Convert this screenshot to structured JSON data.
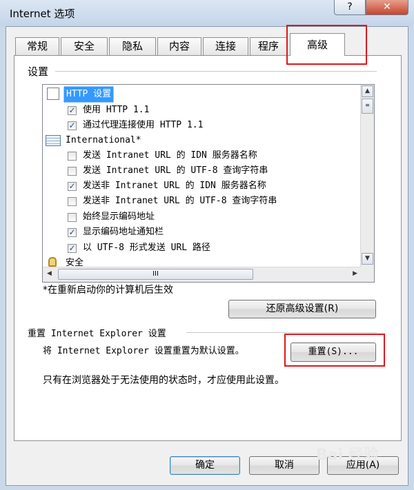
{
  "window": {
    "title": "Internet 选项",
    "help_label": "?",
    "close_label": "✕"
  },
  "tabs": [
    "常规",
    "安全",
    "隐私",
    "内容",
    "连接",
    "程序",
    "高级"
  ],
  "settings": {
    "group_label": "设置",
    "items": [
      {
        "type": "folder",
        "label": "HTTP 设置",
        "selected": true
      },
      {
        "type": "check",
        "label": "使用 HTTP 1.1",
        "checked": true
      },
      {
        "type": "check",
        "label": "通过代理连接使用 HTTP 1.1",
        "checked": true
      },
      {
        "type": "folder",
        "label": "International*"
      },
      {
        "type": "check",
        "label": "发送 Intranet URL 的 IDN 服务器名称",
        "checked": false
      },
      {
        "type": "check",
        "label": "发送 Intranet URL 的 UTF-8 查询字符串",
        "checked": false
      },
      {
        "type": "check",
        "label": "发送非 Intranet URL 的 IDN 服务器名称",
        "checked": true
      },
      {
        "type": "check",
        "label": "发送非 Intranet URL 的 UTF-8 查询字符串",
        "checked": false
      },
      {
        "type": "check",
        "label": "始终显示编码地址",
        "checked": false
      },
      {
        "type": "check",
        "label": "显示编码地址通知栏",
        "checked": true
      },
      {
        "type": "check",
        "label": "以 UTF-8 形式发送 URL 路径",
        "checked": true
      },
      {
        "type": "folder-lock",
        "label": "安全"
      }
    ],
    "hscroll_thumb_label": "III",
    "restart_note": "*在重新启动你的计算机后生效",
    "restore_button": "还原高级设置(R)"
  },
  "reset": {
    "group_label": "重置 Internet Explorer 设置",
    "description": "将 Internet Explorer 设置重置为默认设置。",
    "button": "重置(S)...",
    "note": "只有在浏览器处于无法使用的状态时，才应使用此设置。"
  },
  "footer": {
    "ok": "确定",
    "cancel": "取消",
    "apply": "应用(A)"
  },
  "watermark": "Bai 经验",
  "colors": {
    "highlight": "#e0161c",
    "selection": "#3399ff",
    "check": "#2a4d8f"
  }
}
